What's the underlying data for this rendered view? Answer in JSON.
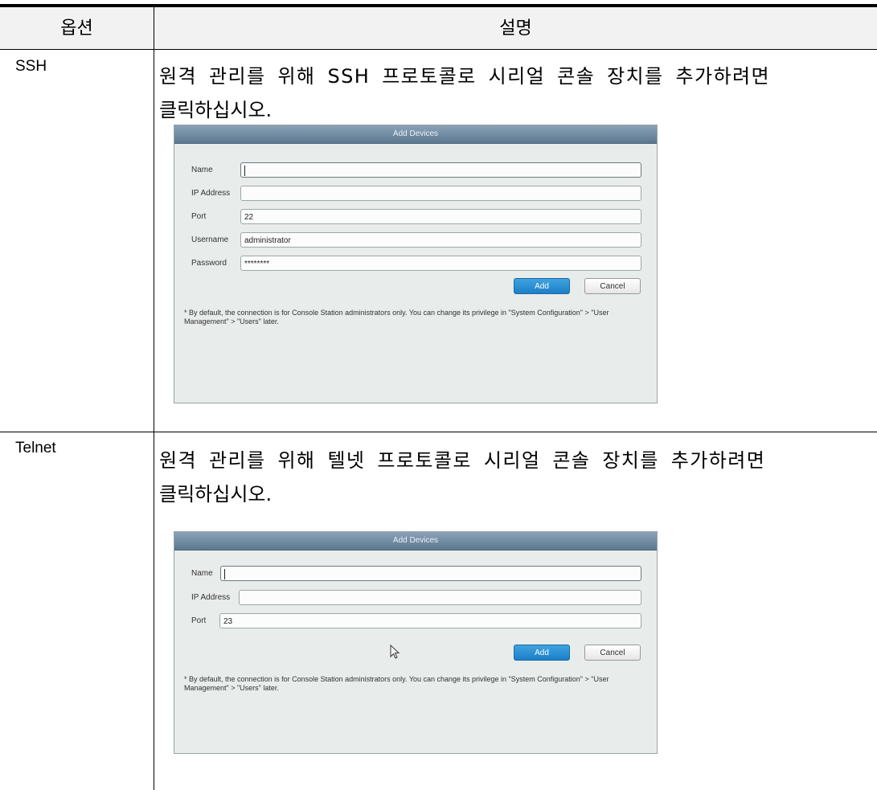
{
  "table": {
    "header": {
      "option": "옵션",
      "description": "설명"
    },
    "rows": [
      {
        "option": "SSH",
        "description_line1": "원격 관리를 위해 SSH 프로토콜로 시리얼 콘솔 장치를 추가하려면",
        "description_line2": "클릭하십시오.",
        "dialog": {
          "title": "Add Devices",
          "fields": [
            {
              "label": "Name",
              "value": ""
            },
            {
              "label": "IP Address",
              "value": ""
            },
            {
              "label": "Port",
              "value": "22"
            },
            {
              "label": "Username",
              "value": "administrator"
            },
            {
              "label": "Password",
              "value": "********"
            }
          ],
          "add_label": "Add",
          "cancel_label": "Cancel",
          "note": "* By default, the connection is for Console Station administrators only. You can change its privilege in \"System Configuration\" > \"User Management\" > \"Users\" later."
        }
      },
      {
        "option": "Telnet",
        "description_line1": "원격 관리를 위해 텔넷 프로토콜로 시리얼 콘솔 장치를 추가하려면",
        "description_line2": "클릭하십시오.",
        "dialog": {
          "title": "Add Devices",
          "fields": [
            {
              "label": "Name",
              "value": ""
            },
            {
              "label": "IP Address",
              "value": ""
            },
            {
              "label": "Port",
              "value": "23"
            }
          ],
          "add_label": "Add",
          "cancel_label": "Cancel",
          "note": "* By default, the connection is for Console Station administrators only. You can change its privilege in \"System Configuration\" > \"User Management\" > \"Users\" later."
        }
      }
    ]
  },
  "colors": {
    "title_bar": "#6f8aa2",
    "add_button": "#2a8fd6",
    "dialog_bg": "#e8ecea"
  },
  "icons": {
    "pointer": "mouse-pointer-icon"
  }
}
